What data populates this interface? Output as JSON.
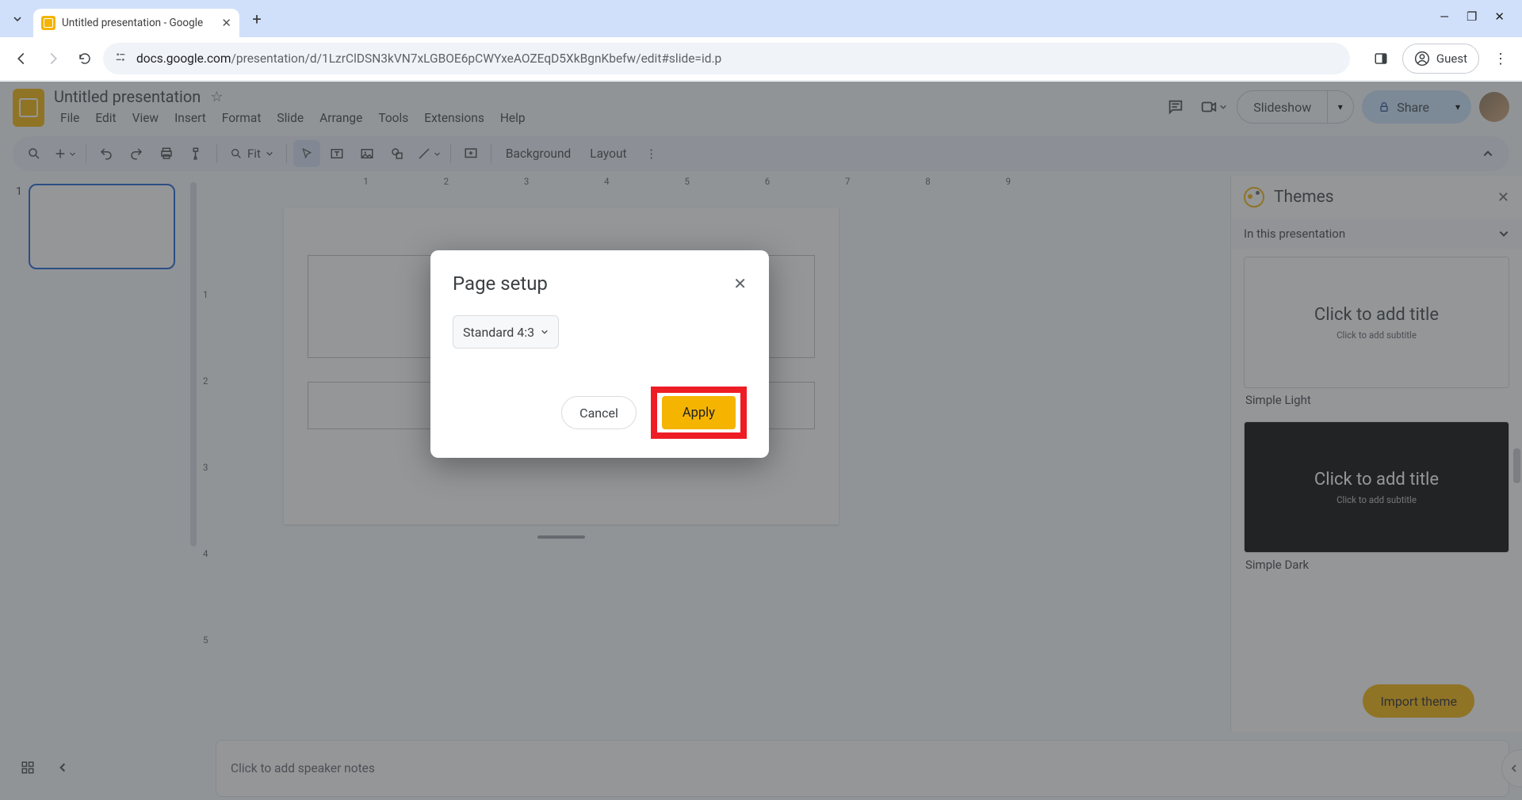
{
  "browser": {
    "tab_title": "Untitled presentation - Google",
    "url_host": "docs.google.com",
    "url_path": "/presentation/d/1LzrClDSN3kVN7xLGBOE6pCWYxeAOZEqD5XkBgnKbefw/edit#slide=id.p",
    "guest_label": "Guest"
  },
  "app": {
    "doc_title": "Untitled presentation",
    "menus": [
      "File",
      "Edit",
      "View",
      "Insert",
      "Format",
      "Slide",
      "Arrange",
      "Tools",
      "Extensions",
      "Help"
    ],
    "slideshow_label": "Slideshow",
    "share_label": "Share"
  },
  "toolbar": {
    "zoom_label": "Fit",
    "background_label": "Background",
    "layout_label": "Layout"
  },
  "ruler": {
    "h": [
      "1",
      "2",
      "3",
      "4",
      "5",
      "6",
      "7",
      "8",
      "9"
    ],
    "v": [
      "1",
      "2",
      "3",
      "4",
      "5"
    ]
  },
  "filmstrip": {
    "slide_number": "1"
  },
  "notes": {
    "placeholder": "Click to add speaker notes"
  },
  "themes": {
    "title": "Themes",
    "subheader": "In this presentation",
    "items": [
      {
        "title": "Click to add title",
        "subtitle": "Click to add subtitle",
        "label": "Simple Light"
      },
      {
        "title": "Click to add title",
        "subtitle": "Click to add subtitle",
        "label": "Simple Dark"
      }
    ],
    "import_label": "Import theme"
  },
  "dialog": {
    "title": "Page setup",
    "ratio_label": "Standard 4:3",
    "cancel_label": "Cancel",
    "apply_label": "Apply"
  }
}
